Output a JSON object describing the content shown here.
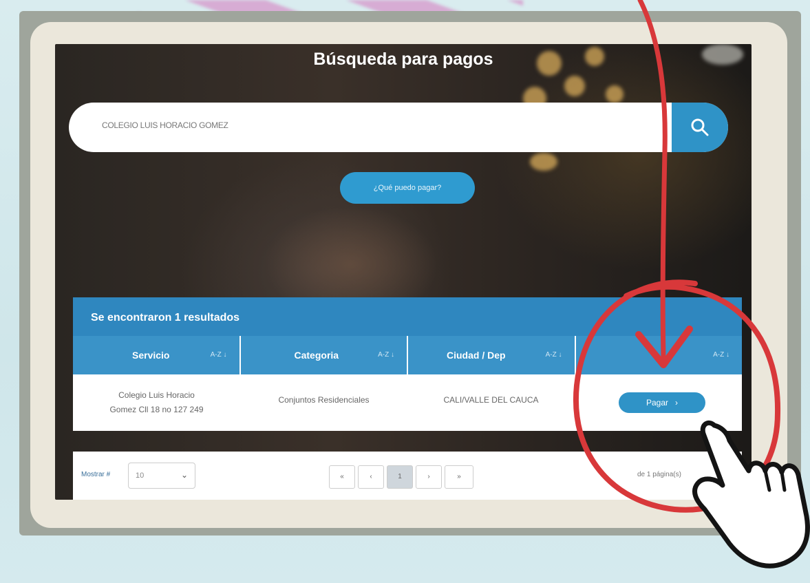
{
  "page": {
    "title": "Búsqueda para pagos",
    "help_button": "¿Qué puedo pagar?"
  },
  "search": {
    "value": "COLEGIO LUIS HORACIO GOMEZ",
    "button_icon": "search-icon"
  },
  "results": {
    "header": "Se encontraron 1 resultados",
    "columns": [
      {
        "label": "Servicio",
        "sort": "A-Z ↓"
      },
      {
        "label": "Categoria",
        "sort": "A-Z ↓"
      },
      {
        "label": "Ciudad / Dep",
        "sort": "A-Z ↓"
      },
      {
        "label": "",
        "sort": "A-Z ↓"
      }
    ],
    "rows": [
      {
        "servicio_line1": "Colegio Luis Horacio",
        "servicio_line2": "Gomez Cll 18 no 127 249",
        "categoria": "Conjuntos Residenciales",
        "ciudad": "CALI/VALLE DEL CAUCA",
        "action": "Pagar"
      }
    ]
  },
  "pager": {
    "show_label": "Mostrar #",
    "page_size": "10",
    "first": "«",
    "prev": "‹",
    "current": "1",
    "next": "›",
    "last": "»",
    "info": "de 1 página(s)"
  },
  "colors": {
    "accent": "#2f93c7",
    "header_bar": "#2f87bf",
    "annotation": "#d8383a"
  }
}
